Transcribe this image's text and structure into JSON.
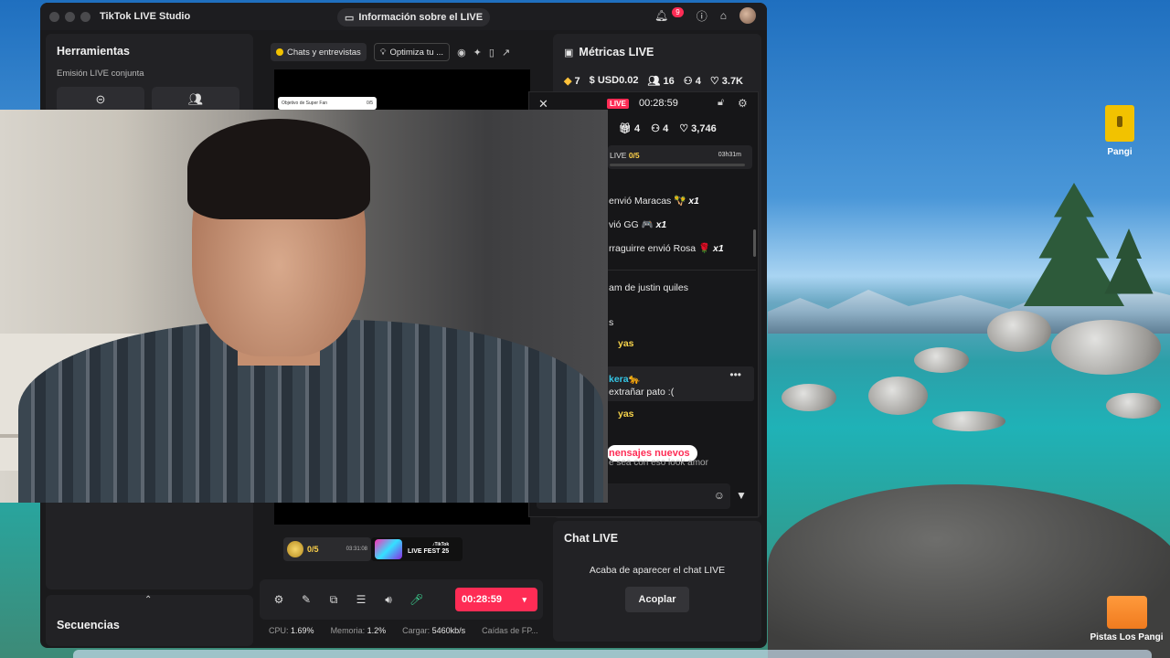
{
  "window": {
    "app_title": "TikTok LIVE Studio",
    "info_pill": "Información sobre el LIVE",
    "notification_count": "9"
  },
  "tools": {
    "title": "Herramientas",
    "section_label": "Emisión LIVE conjunta"
  },
  "center": {
    "chip_chats": "Chats y entrevistas",
    "chip_optimize": "Optimiza tu ...",
    "superfan_label": "Objetivo de Super Fan",
    "superfan_count": "0/5",
    "medal_progress": "0/5",
    "medal_time": "03:31:08",
    "fest_label": "LIVE FEST 25",
    "fest_brand": "♪TikTok",
    "timer": "00:28:59"
  },
  "status": {
    "cpu_label": "CPU:",
    "cpu_value": "1.69%",
    "mem_label": "Memoria:",
    "mem_value": "1.2%",
    "load_label": "Cargar:",
    "load_value": "5460kb/s",
    "drops_label": "Caídas de FP..."
  },
  "metrics": {
    "title": "Métricas LIVE",
    "diamonds": "7",
    "usd": "USD0.02",
    "viewers": "16",
    "followers": "4",
    "likes": "3.7K"
  },
  "overlay": {
    "live_tag": "LIVE",
    "timer": "00:28:59",
    "stat_gifts": "4",
    "stat_users": "4",
    "stat_likes": "3,746",
    "progress_label": "LIVE",
    "progress_value": "0/5",
    "progress_time": "03h31m",
    "gift_lines": [
      {
        "text": "envió Maracas 🪇",
        "mult": "x1"
      },
      {
        "text": "vió GG 🎮",
        "mult": "x1"
      },
      {
        "text": "rraguirre envió Rosa 🌹",
        "mult": "x1"
      }
    ],
    "chat_lines": {
      "line1": "am de justin quiles",
      "line2": "s",
      "line3": "yas",
      "line4_user": "kera🐆",
      "line4_text": "extrañar pato :(",
      "line5": "yas",
      "line6": "e sea con eso look amor"
    },
    "new_messages": "nensajes nuevos"
  },
  "chat_panel": {
    "title": "Chat LIVE",
    "message": "Acaba de aparecer el chat LIVE",
    "accept": "Acoplar"
  },
  "sequences": {
    "title": "Secuencias"
  },
  "desktop": {
    "icon_folder": "Pangi",
    "icon_orange": "Pistas Los Pangi"
  },
  "colors": {
    "accent": "#fe2c55",
    "panel": "#222225",
    "window_bg": "#1a1a1c"
  }
}
